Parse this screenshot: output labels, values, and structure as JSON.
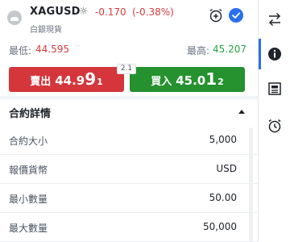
{
  "instrument": {
    "symbol": "XAGUSD",
    "description": "白銀現貨",
    "change": "-0.170",
    "change_pct": "(-0.38%)"
  },
  "range": {
    "low_label": "最低:",
    "low_value": "44.595",
    "high_label": "最高:",
    "high_value": "45.207"
  },
  "trade": {
    "sell_label": "賣出",
    "sell_price_main": "44.9",
    "sell_price_big": "9",
    "sell_price_small": "1",
    "buy_label": "買入",
    "buy_price_main": "45.0",
    "buy_price_big": "1",
    "buy_price_small": "2",
    "spread": "2.1"
  },
  "contract": {
    "title": "合約詳情",
    "rows": [
      {
        "label": "合約大小",
        "value": "5,000"
      },
      {
        "label": "報價貨幣",
        "value": "USD"
      },
      {
        "label": "最小數量",
        "value": "50.00"
      },
      {
        "label": "最大數量",
        "value": "50,000"
      }
    ]
  },
  "colors": {
    "sell": "#d4363b",
    "buy": "#25912f",
    "negative": "#d93a3a",
    "positive": "#27a243",
    "accent": "#2a6ff0"
  },
  "icons": {
    "sidebar": [
      "swap-arrows-icon",
      "info-icon",
      "newspaper-icon",
      "alarm-clock-icon"
    ]
  }
}
